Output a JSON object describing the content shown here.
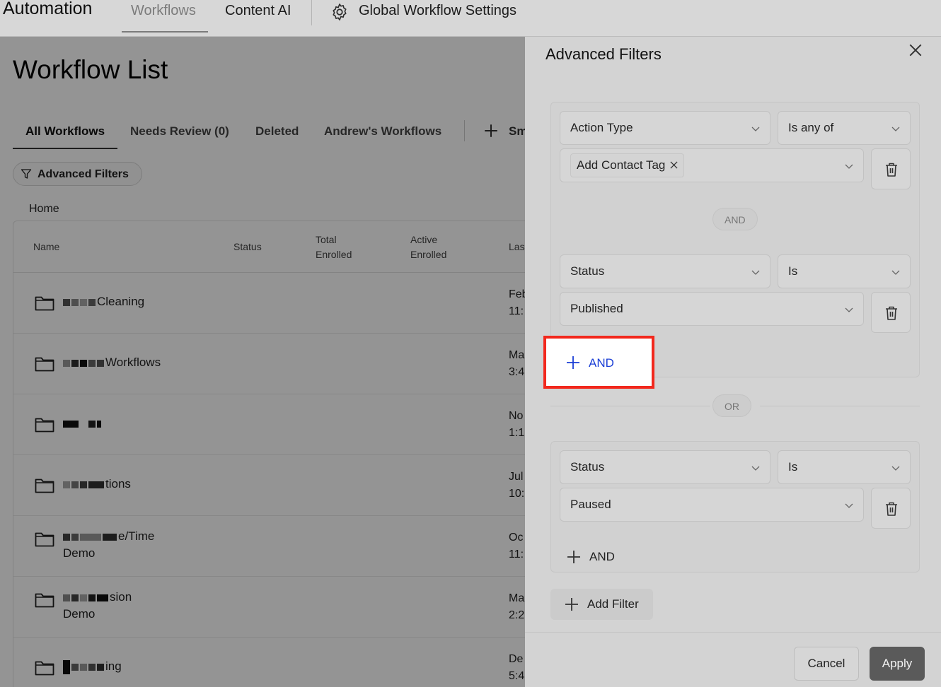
{
  "topnav": {
    "brand": "Automation",
    "items": [
      "Workflows",
      "Content AI",
      "Global Workflow Settings"
    ]
  },
  "page": {
    "title": "Workflow List",
    "tabs": [
      "All Workflows",
      "Needs Review (0)",
      "Deleted",
      "Andrew's Workflows",
      "Sm"
    ],
    "advanced_filters_label": "Advanced Filters",
    "breadcrumb": "Home",
    "columns": [
      "Name",
      "Status",
      "Total Enrolled",
      "Active Enrolled",
      "Las"
    ],
    "columns_split": {
      "total": [
        "Total",
        "Enrolled"
      ],
      "active": [
        "Active",
        "Enrolled"
      ]
    },
    "rows": [
      {
        "name": "Cleaning",
        "name2": "",
        "date1": "Feb",
        "date2": "11:"
      },
      {
        "name": "Workflows",
        "name2": "",
        "date1": "Ma",
        "date2": "3:4"
      },
      {
        "name": "",
        "name2": "",
        "date1": "No",
        "date2": "1:1"
      },
      {
        "name": "tions",
        "name2": "",
        "date1": "Jul",
        "date2": "10:"
      },
      {
        "name": "e/Time",
        "name2": "Demo",
        "date1": "Oc",
        "date2": "11:"
      },
      {
        "name": "sion",
        "name2": "Demo",
        "date1": "Ma",
        "date2": "2:2"
      },
      {
        "name": "ing",
        "name2": "",
        "date1": "De",
        "date2": "5:4"
      }
    ]
  },
  "drawer": {
    "title": "Advanced Filters",
    "group1": {
      "field": "Action Type",
      "operator": "Is any of",
      "chip": "Add Contact Tag",
      "connector": "AND",
      "field2": "Status",
      "operator2": "Is",
      "value2": "Published",
      "add_and": "AND"
    },
    "or_label": "OR",
    "group2": {
      "field": "Status",
      "operator": "Is",
      "value": "Paused",
      "add_and": "AND"
    },
    "add_filter": "Add Filter",
    "cancel": "Cancel",
    "apply": "Apply"
  },
  "colors": {
    "highlight_border": "#f2281d",
    "and_link": "#1b3fd6",
    "apply_bg": "#5a5a5a"
  }
}
